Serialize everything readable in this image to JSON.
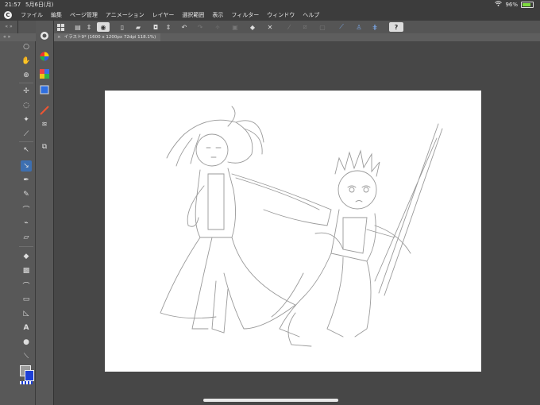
{
  "status": {
    "time": "21:57",
    "date": "5月6日(月)",
    "battery": "96%"
  },
  "menu": {
    "logo": "C",
    "items": [
      "ファイル",
      "編集",
      "ページ管理",
      "アニメーション",
      "レイヤー",
      "選択範囲",
      "表示",
      "フィルター",
      "ウィンドウ",
      "ヘルプ"
    ]
  },
  "leftpanel": {
    "collapse": "«  »"
  },
  "tool_header": {
    "expand": "«  »"
  },
  "tab": {
    "title": "イラスト9* (1600 x 1200px 72dpi 118.1%)",
    "close": "×"
  },
  "toolbar": {
    "help": "?"
  },
  "colors": {
    "main": "#9b9b9b",
    "sub": "#1d3fd6"
  },
  "icons": {
    "tool1": [
      "select-arrow",
      "hand",
      "magnify",
      "move-layer",
      "lasso",
      "wand",
      "eyedropper",
      "operation-arrow",
      "select-pen",
      "pen",
      "pencil-light",
      "brush",
      "airbrush",
      "eraser",
      "blend",
      "fill",
      "gradient",
      "curve",
      "frame-border",
      "ruler",
      "text",
      "balloon",
      "correction-line"
    ],
    "tool2": [
      "navigator",
      "color-wheel",
      "color-set",
      "layer",
      "brush-size",
      "sub-tool",
      "gradient-set"
    ]
  }
}
